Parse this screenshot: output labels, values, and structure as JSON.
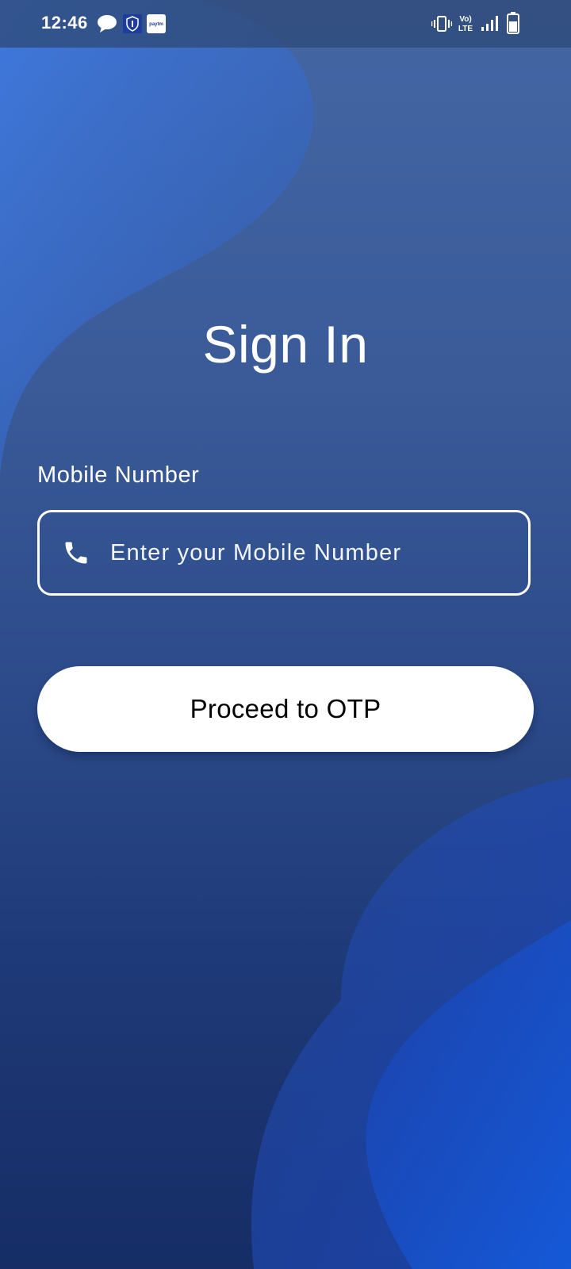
{
  "status_bar": {
    "time": "12:46",
    "notification_icons": [
      "message-icon",
      "shield-app-icon",
      "paytm-icon"
    ],
    "paytm_text": "paytm",
    "volte_text_top": "Vo)",
    "volte_text_bottom": "LTE",
    "system_icons": [
      "vibrate-icon",
      "volte-icon",
      "signal-icon",
      "battery-icon"
    ]
  },
  "page": {
    "title": "Sign In"
  },
  "mobile_field": {
    "label": "Mobile Number",
    "placeholder": "Enter your Mobile Number",
    "value": "",
    "icon": "phone-icon"
  },
  "proceed_button": {
    "label": "Proceed to OTP"
  },
  "colors": {
    "background_top": "#4467a4",
    "background_bottom": "#162d66",
    "accent_wave": "#1a4fc4",
    "button_bg": "#ffffff",
    "button_text": "#000000",
    "text": "#ffffff"
  }
}
